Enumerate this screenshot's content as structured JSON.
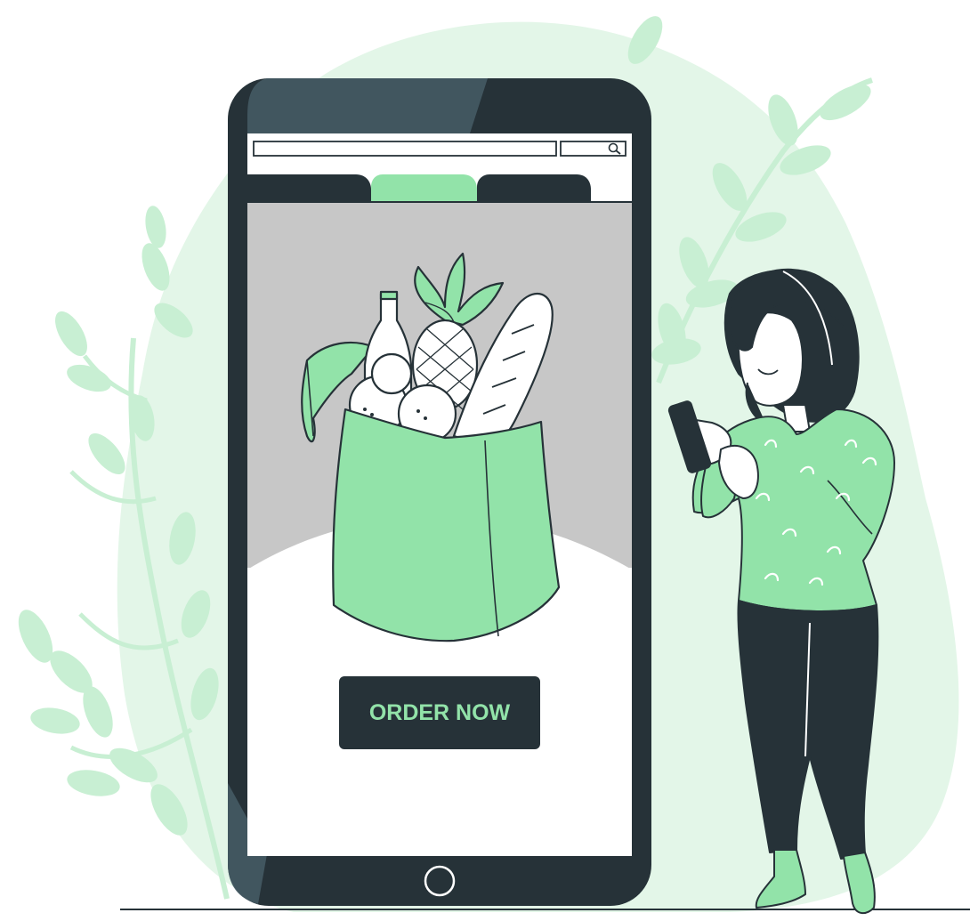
{
  "screen": {
    "search": {
      "placeholder": "",
      "icon": "search-icon"
    },
    "tabs": [
      {
        "label": "",
        "active": false
      },
      {
        "label": "",
        "active": true
      },
      {
        "label": "",
        "active": false
      }
    ],
    "cta": {
      "label": "ORDER NOW"
    }
  },
  "colors": {
    "accent": "#92e3a9",
    "dark": "#263238",
    "blob": "#e3f6e8",
    "screen_bg": "#c7c7c7"
  }
}
